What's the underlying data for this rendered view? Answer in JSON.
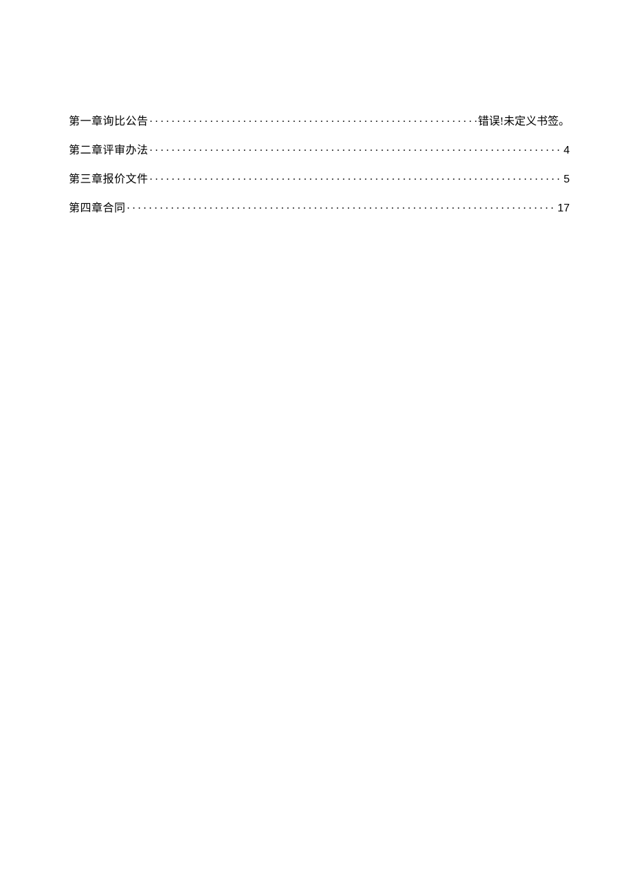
{
  "toc": {
    "entries": [
      {
        "title": "第一章询比公告",
        "page": "错误!未定义书签。",
        "page_is_cn": true
      },
      {
        "title": "第二章评审办法",
        "page": "4",
        "page_is_cn": false
      },
      {
        "title": "第三章报价文件",
        "page": "5",
        "page_is_cn": false
      },
      {
        "title": "第四章合同",
        "page": "17",
        "page_is_cn": false
      }
    ]
  }
}
